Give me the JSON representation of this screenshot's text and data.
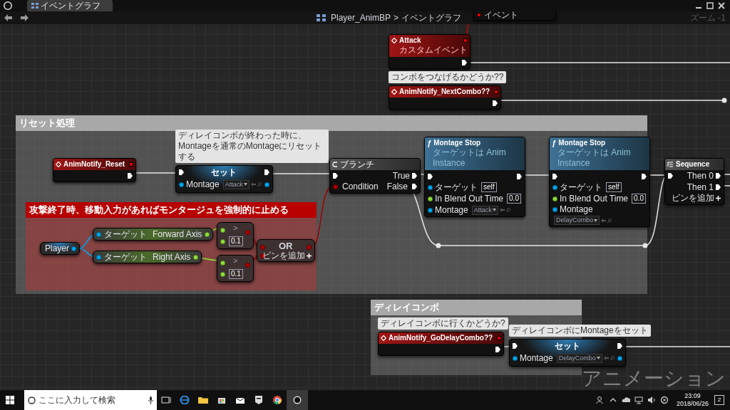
{
  "tab": {
    "label": "イベントグラフ"
  },
  "breadcrumb": {
    "asset": "Player_AnimBP",
    "separator": ">",
    "graph": "イベントグラフ"
  },
  "zoom": "ズーム -1",
  "graph_label": "アニメーション",
  "comments": [
    {
      "title": "リセット処理",
      "color": "#a8a8a8"
    },
    {
      "title": "攻撃終了時、移動入力があればモンタージュを強制的に止める",
      "color": "#b80000"
    },
    {
      "title": "ディレイコンボ",
      "color": "#a8a8a8"
    }
  ],
  "nodes": [
    {
      "kind": "fragment",
      "title": "イベント"
    },
    {
      "kind": "event",
      "title": "Attack",
      "subtitle": "カスタムイベント"
    },
    {
      "kind": "event",
      "title": "AnimNotify_NextCombo??",
      "comment": "コンボをつなげるかどうか??"
    },
    {
      "kind": "event",
      "title": "AnimNotify_Reset"
    },
    {
      "kind": "set",
      "title": "セット",
      "comment": "ディレイコンボが終わった時に、Montageを通常のMontageにリセットする",
      "inputs": [
        {
          "label": "Montage",
          "kind": "object",
          "dropdown": "Attack"
        }
      ]
    },
    {
      "kind": "branch",
      "title": "ブランチ",
      "inputs": [
        {
          "label": "Condition",
          "kind": "bool"
        }
      ],
      "outputs": [
        {
          "label": "True",
          "kind": "exec"
        },
        {
          "label": "False",
          "kind": "exec"
        }
      ]
    },
    {
      "kind": "function",
      "icon": "ƒ",
      "title": "Montage Stop",
      "subtitle": "ターゲットは Anim Instance",
      "inputs": [
        {
          "label": "ターゲット",
          "kind": "object",
          "value": "self"
        },
        {
          "label": "In Blend Out Time",
          "kind": "float",
          "value": "0.0"
        },
        {
          "label": "Montage",
          "kind": "object",
          "dropdown": "Attack"
        }
      ]
    },
    {
      "kind": "function",
      "icon": "ƒ",
      "title": "Montage Stop",
      "subtitle": "ターゲットは Anim Instance",
      "inputs": [
        {
          "label": "ターゲット",
          "kind": "object",
          "value": "self"
        },
        {
          "label": "In Blend Out Time",
          "kind": "float",
          "value": "0.0"
        },
        {
          "label": "Montage",
          "kind": "object",
          "dropdown": "DelayCombo"
        }
      ]
    },
    {
      "kind": "sequence",
      "title": "Sequence",
      "outputs": [
        {
          "label": "Then 0",
          "kind": "exec"
        },
        {
          "label": "Then 1",
          "kind": "exec"
        }
      ],
      "add_pin": "ピンを追加"
    },
    {
      "kind": "variable",
      "title": "Player"
    },
    {
      "kind": "getter",
      "inputs": [
        {
          "label": "ターゲット",
          "kind": "object"
        }
      ],
      "outputs": [
        {
          "label": "Forward Axis",
          "kind": "float"
        }
      ]
    },
    {
      "kind": "getter",
      "inputs": [
        {
          "label": "ターゲット",
          "kind": "object"
        }
      ],
      "outputs": [
        {
          "label": "Right Axis",
          "kind": "float"
        }
      ]
    },
    {
      "kind": "compare",
      "symbol": ">",
      "inputs": [
        {
          "kind": "float"
        },
        {
          "kind": "float",
          "value": "0.1"
        }
      ]
    },
    {
      "kind": "compare",
      "symbol": ">",
      "inputs": [
        {
          "kind": "float"
        },
        {
          "kind": "float",
          "value": "0.1"
        }
      ]
    },
    {
      "kind": "or",
      "title": "OR",
      "add_pin": "ピンを追加"
    },
    {
      "kind": "event",
      "title": "AnimNotify_GoDelayCombo??",
      "comment": "ディレイコンボに行くかどうか?"
    },
    {
      "kind": "set",
      "title": "セット",
      "comment": "ディレイコンボにMontageをセット",
      "inputs": [
        {
          "label": "Montage",
          "kind": "object",
          "dropdown": "DelayCombo"
        }
      ]
    }
  ],
  "taskbar": {
    "search_placeholder": "ここに入力して検索",
    "time": "23:09",
    "date": "2018/06/26",
    "notifications": "2"
  }
}
